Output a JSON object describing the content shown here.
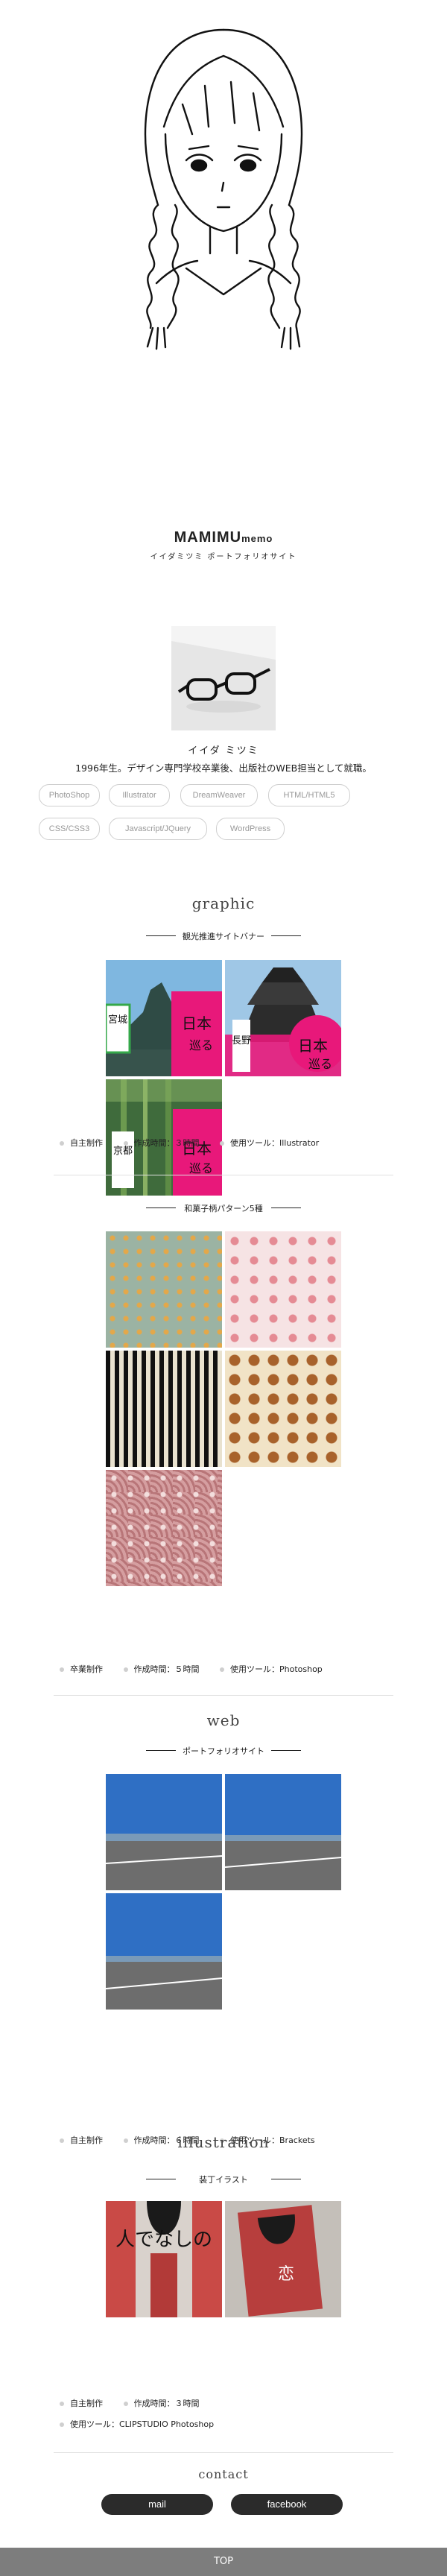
{
  "site": {
    "title_main": "MAMIMU",
    "title_small": "memo",
    "subtitle": "イイダミツミ ポートフォリオサイト"
  },
  "profile": {
    "name": "イイダ ミツミ",
    "description": "1996年生。デザイン専門学校卒業後、出版社のWEB担当として就職。",
    "skills": [
      "PhotoShop",
      "Illustrator",
      "DreamWeaver",
      "HTML/HTML5",
      "CSS/CSS3",
      "Javascript/JQuery",
      "WordPress"
    ]
  },
  "sections": {
    "graphic": "graphic",
    "web": "web",
    "illustration": "illustration",
    "contact": "contact"
  },
  "works": [
    {
      "title": "観光推進サイトバナー",
      "meta": [
        "自主制作",
        "作成時間：３時間",
        "使用ツール：Illustrator"
      ],
      "banner_text": {
        "miyagi": "宮城",
        "nagano": "長野",
        "kyoto": "京都",
        "nihon": "日本",
        "meguru": "巡る",
        "small": "日本と日本を楽しむ"
      }
    },
    {
      "title": "和菓子柄パターン5種",
      "meta": [
        "卒業制作",
        "作成時間：５時間",
        "使用ツール：Photoshop"
      ]
    },
    {
      "title": "ポートフォリオサイト",
      "meta": [
        "自主制作",
        "作成時間：６時間",
        "使用ツール：Brackets"
      ]
    },
    {
      "title": "装丁イラスト",
      "meta": [
        "自主制作",
        "作成時間：３時間",
        "使用ツール：CLIPSTUDIO Photoshop"
      ],
      "cover_text": {
        "left": "人でなしの",
        "right": "恋"
      }
    }
  ],
  "contact": {
    "mail": "mail",
    "facebook": "facebook"
  },
  "footer": {
    "top": "TOP"
  },
  "colors": {
    "pink": "#e8187a",
    "dark": "#2b2b2b",
    "footer": "#7d7d7d"
  }
}
